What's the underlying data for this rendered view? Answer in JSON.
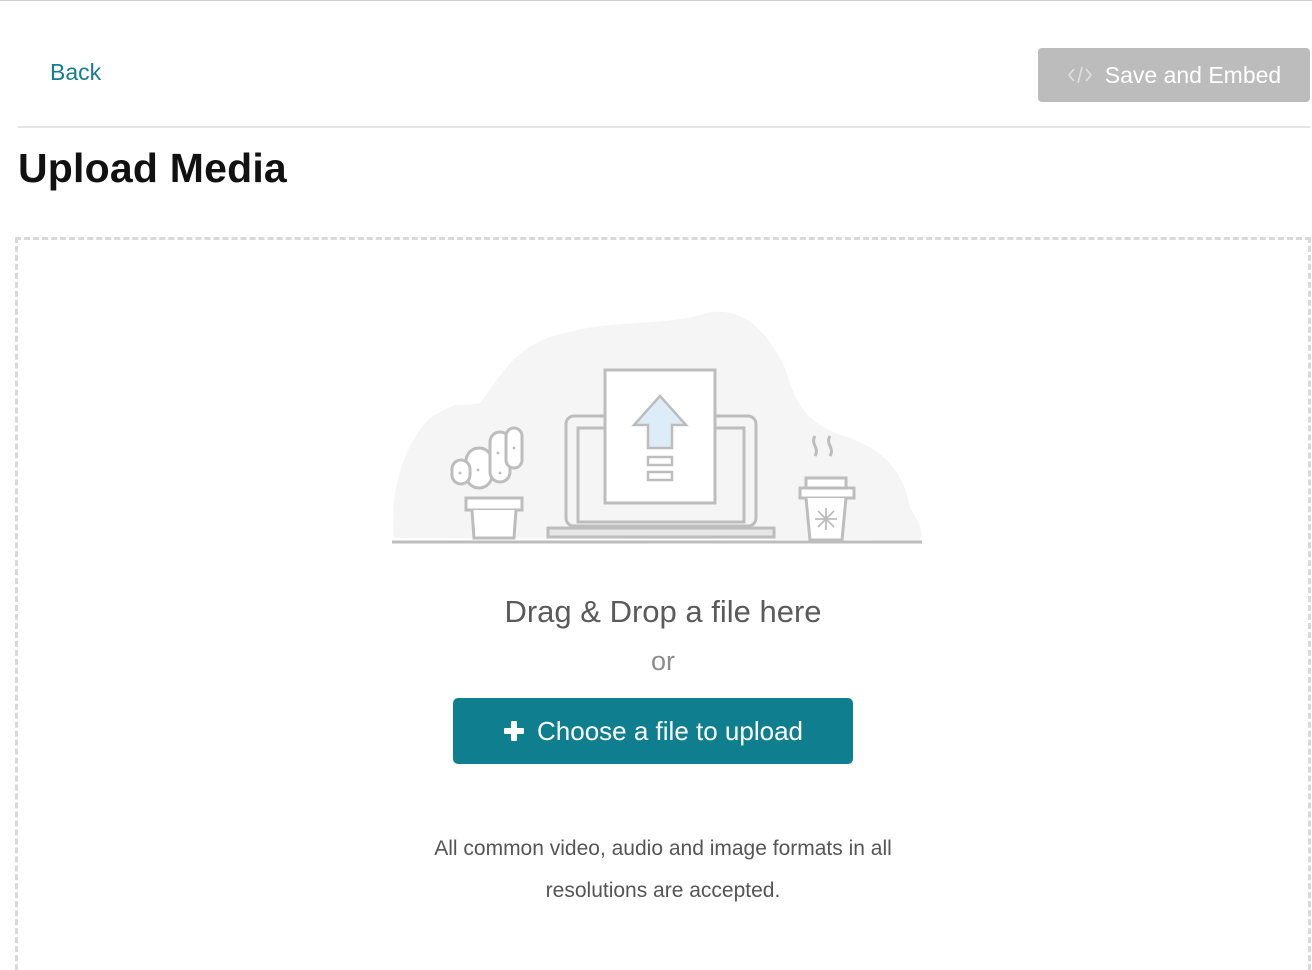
{
  "header": {
    "back_label": "Back",
    "save_label": "Save and Embed",
    "save_icon": "code-icon",
    "save_disabled": true
  },
  "page": {
    "title": "Upload Media"
  },
  "dropzone": {
    "headline": "Drag & Drop a file here",
    "or_text": "or",
    "choose_label": "Choose a file to upload",
    "choose_icon": "plus-icon",
    "note_line1": "All common video, audio and image formats in all",
    "note_line2": "resolutions are accepted.",
    "illustration": "upload-illustration"
  },
  "colors": {
    "accent": "#0f7f8f",
    "link": "#177d8c",
    "disabled_button": "#bcbcbc",
    "border": "#d9d9d9"
  }
}
